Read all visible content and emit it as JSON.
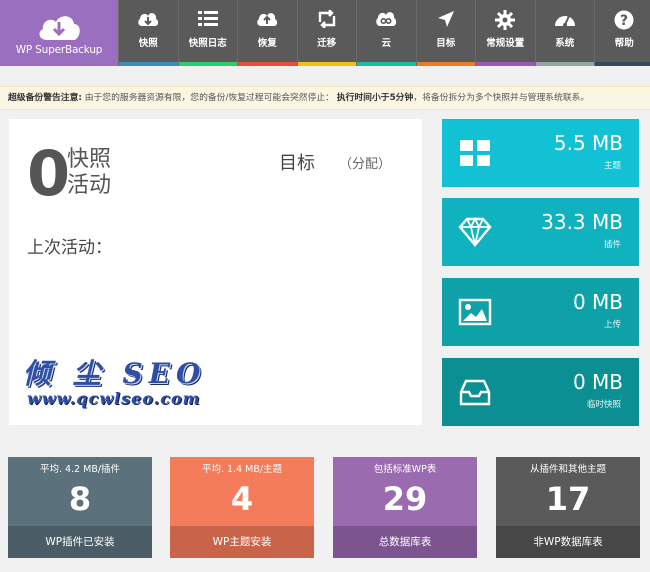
{
  "logo": {
    "text": "WP SuperBackup",
    "color": "#9b6fc0"
  },
  "nav": [
    {
      "label": "快照",
      "icon": "cloud-download-icon",
      "stripe": "#3c8dbc"
    },
    {
      "label": "快照日志",
      "icon": "list-icon",
      "stripe": "#2ecc71"
    },
    {
      "label": "恢复",
      "icon": "cloud-upload-icon",
      "stripe": "#e74c3c"
    },
    {
      "label": "迁移",
      "icon": "retweet-icon",
      "stripe": "#f1c40f"
    },
    {
      "label": "云",
      "icon": "cloud-link-icon",
      "stripe": "#1abc9c"
    },
    {
      "label": "目标",
      "icon": "location-arrow-icon",
      "stripe": "#e67e22"
    },
    {
      "label": "常规设置",
      "icon": "gear-icon",
      "stripe": "#9b59b6"
    },
    {
      "label": "系统",
      "icon": "dashboard-icon",
      "stripe": "#95a5a6"
    },
    {
      "label": "帮助",
      "icon": "question-icon",
      "stripe": "#34495e"
    }
  ],
  "notice": {
    "title": "超级备份警告注意:",
    "body": "由于您的服务器资源有限，您的备份/恢复过程可能会突然停止：",
    "emphasis": "执行时间小于5分钟",
    "tail": "，将备份拆分为多个快照并与管理系统联系。"
  },
  "main": {
    "count": "0",
    "snap_label_1": "快照",
    "snap_label_2": "活动",
    "target_label": "目标",
    "target_alloc": "（分配）",
    "last_activity": "上次活动：",
    "watermark_line1": "倾 尘 SEO",
    "watermark_line2": "www.qcwlseo.com"
  },
  "tiles": [
    {
      "value": "5.5 MB",
      "sub": "主题",
      "icon": "grid-icon",
      "color": "#12c2d4"
    },
    {
      "value": "33.3 MB",
      "sub": "插件",
      "icon": "diamond-icon",
      "color": "#10b2bf"
    },
    {
      "value": "0 MB",
      "sub": "上传",
      "icon": "image-icon",
      "color": "#0fa1a8"
    },
    {
      "value": "0 MB",
      "sub": "临时快照",
      "icon": "inbox-icon",
      "color": "#0b8f93"
    }
  ],
  "cards": [
    {
      "top": "平均. 4.2 MB/插件",
      "num": "8",
      "foot": "WP插件已安装",
      "color": "#5b717c",
      "foot_color": "#4a5d66"
    },
    {
      "top": "平均. 1.4 MB/主题",
      "num": "4",
      "foot": "WP主题安装",
      "color": "#f47c5a",
      "foot_color": "#c7644a"
    },
    {
      "top": "包括标准WP表",
      "num": "29",
      "foot": "总数据库表",
      "color": "#9b6bb0",
      "foot_color": "#7b5490"
    },
    {
      "top": "从插件和其他主题",
      "num": "17",
      "foot": "非WP数据库表",
      "color": "#5a5a5a",
      "foot_color": "#474747"
    }
  ]
}
